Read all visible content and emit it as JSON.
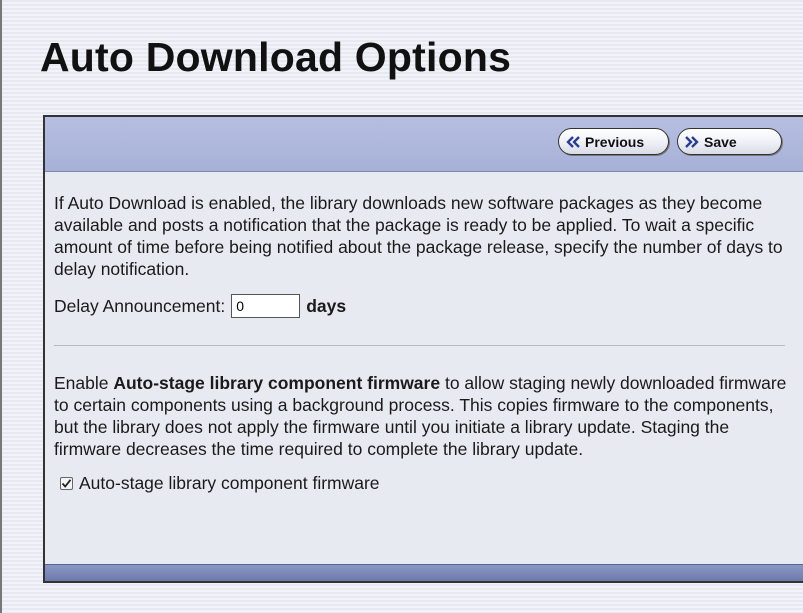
{
  "page": {
    "title": "Auto Download Options"
  },
  "toolbar": {
    "previous_label": "Previous",
    "save_label": "Save",
    "previous_icon": "double-chevron-left-icon",
    "save_icon": "double-chevron-right-icon"
  },
  "auto_download": {
    "description": "If Auto Download is enabled, the library downloads new software packages as they become available and posts a notification that the package is ready to be applied. To wait a specific amount of time before being notified about the package release, specify the number of days to delay notification.",
    "delay_label": "Delay Announcement:",
    "delay_value": "0",
    "delay_unit": "days"
  },
  "auto_stage": {
    "intro": "Enable ",
    "bold_term": "Auto-stage library component firmware",
    "description_rest": " to allow staging newly downloaded firmware to certain components using a background process. This copies firmware to the components, but the library does not apply the firmware until you initiate a library update. Staging the firmware decreases the time required to complete the library update.",
    "checkbox_label": "Auto-stage library component firmware",
    "checked": true
  },
  "colors": {
    "header_band": "#a7b1d8",
    "footer_band": "#6e7aab",
    "page_background": "#e9ecf4"
  }
}
